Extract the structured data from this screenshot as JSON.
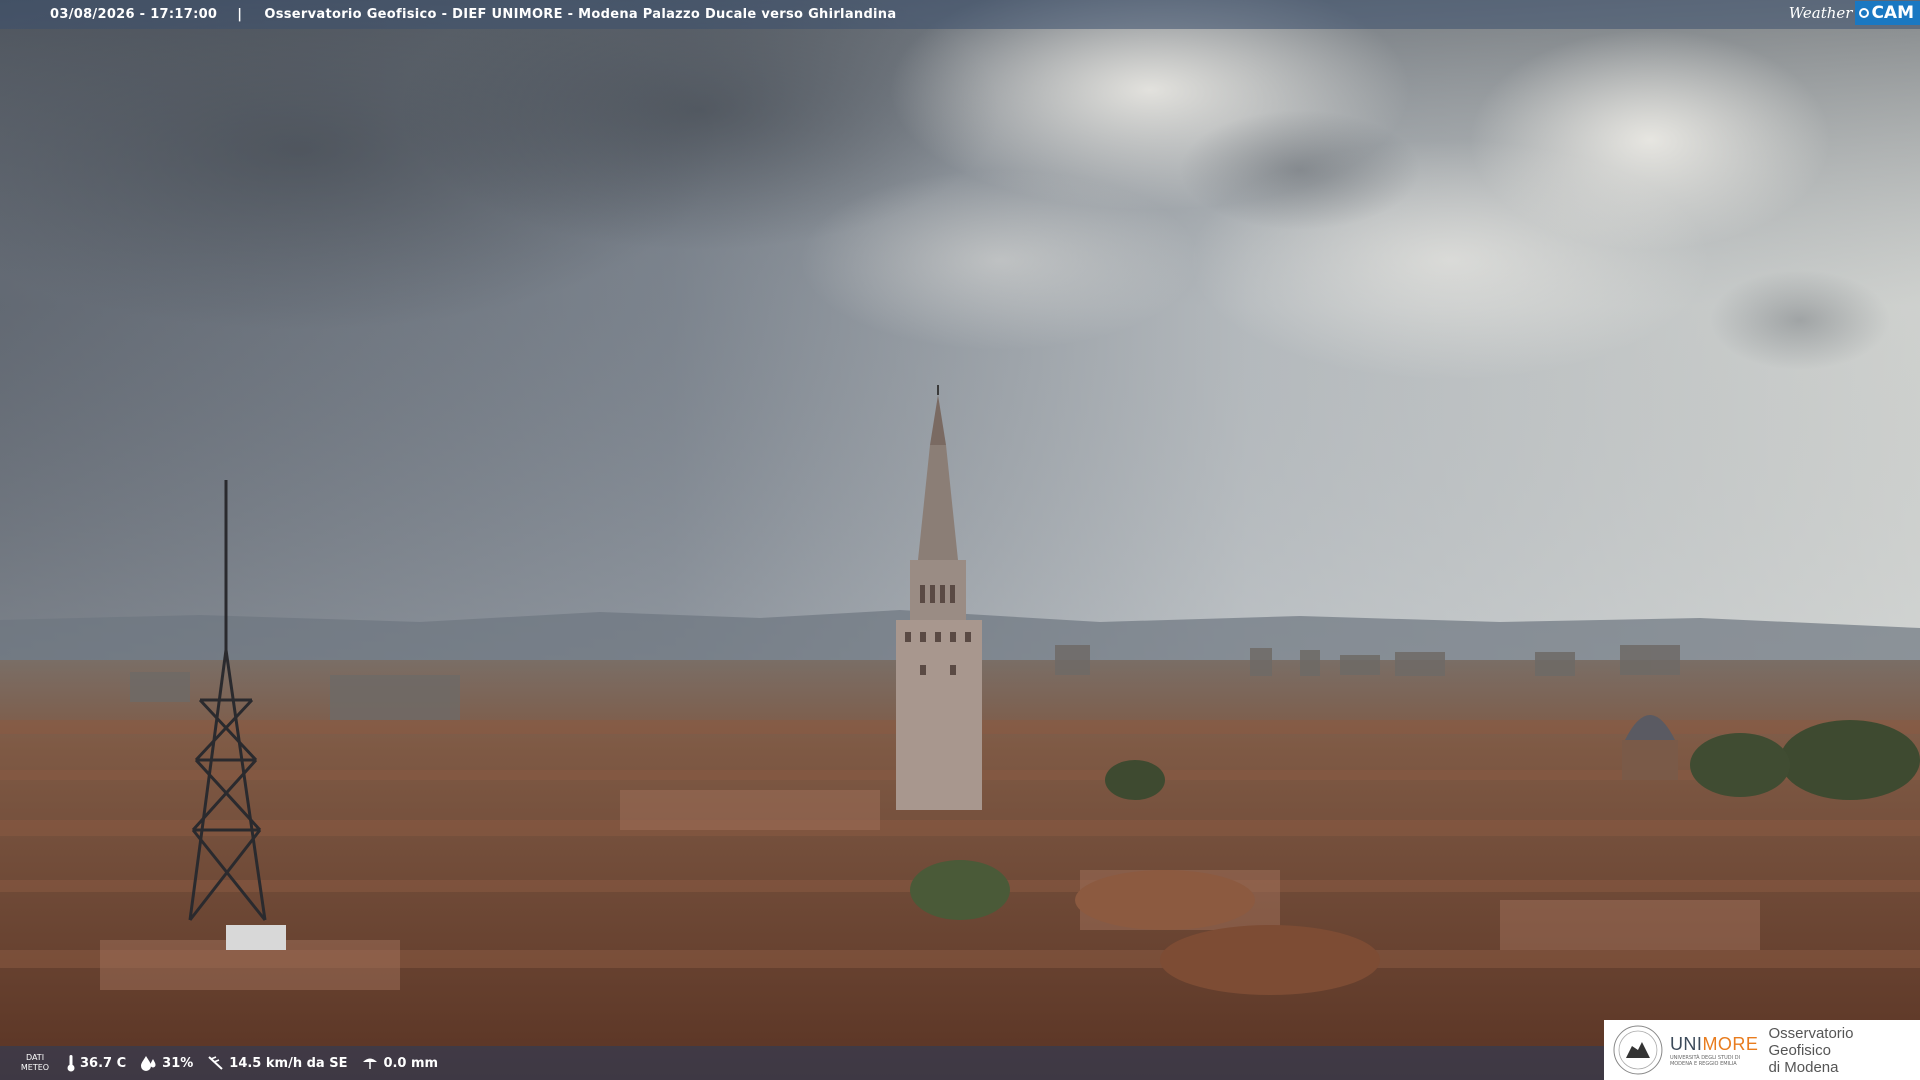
{
  "header": {
    "timestamp": "03/08/2026 - 17:17:00",
    "separator": "|",
    "location": "Osservatorio Geofisico - DIEF UNIMORE - Modena Palazzo Ducale verso Ghirlandina"
  },
  "brand": {
    "weather": "Weather",
    "cam": "CAM"
  },
  "weather_data": {
    "label": "DATI METEO",
    "temperature": "36.7 C",
    "humidity": "31%",
    "wind": "14.5 km/h da SE",
    "rain": "0.0 mm",
    "icons": [
      "thermometer-icon",
      "humidity-icon",
      "wind-icon",
      "rain-icon"
    ]
  },
  "logo": {
    "uni_a": "UNI",
    "uni_b": "MORE",
    "uni_sub": "UNIVERSITÀ DEGLI STUDI DI MODENA E REGGIO EMILIA",
    "observatory_line1": "Osservatorio Geofisico",
    "observatory_line2": "di Modena"
  },
  "colors": {
    "accent": "#1a78c2",
    "unimore_orange": "#e87c1e"
  }
}
